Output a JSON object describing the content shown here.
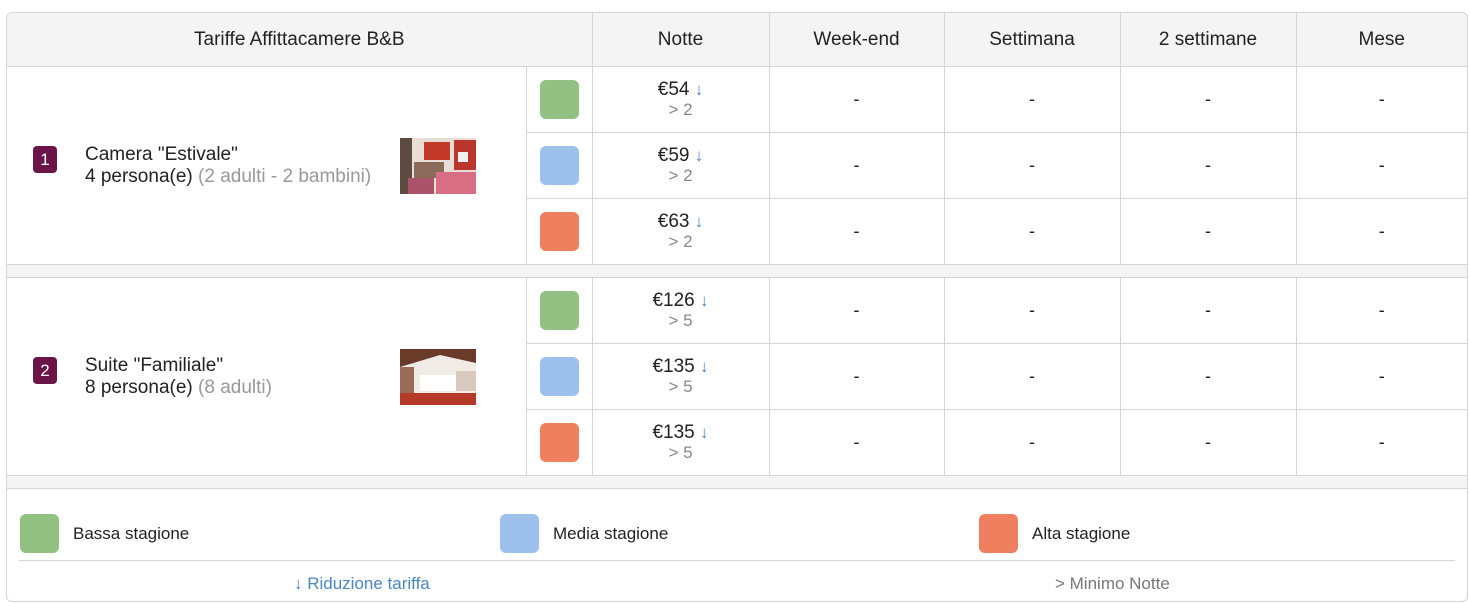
{
  "colors": {
    "low": "#93c083",
    "mid": "#9ec0ec",
    "high": "#ee8060",
    "badge": "#6b1448",
    "link": "#4a86c8"
  },
  "header": {
    "title": "Tariffe Affittacamere B&B",
    "columns": [
      "Notte",
      "Week-end",
      "Settimana",
      "2 settimane",
      "Mese"
    ]
  },
  "rooms": [
    {
      "number": "1",
      "name": "Camera \"Estivale\"",
      "capacity": "4 persona(e)",
      "detail": "(2 adulti - 2 bambini)",
      "thumbnail": "room-photo-estivale",
      "rates": [
        {
          "season": "low",
          "price": "€54",
          "arrow": "↓",
          "min": "> 2",
          "weekend": "-",
          "week": "-",
          "two_weeks": "-",
          "month": "-"
        },
        {
          "season": "mid",
          "price": "€59",
          "arrow": "↓",
          "min": "> 2",
          "weekend": "-",
          "week": "-",
          "two_weeks": "-",
          "month": "-"
        },
        {
          "season": "high",
          "price": "€63",
          "arrow": "↓",
          "min": "> 2",
          "weekend": "-",
          "week": "-",
          "two_weeks": "-",
          "month": "-"
        }
      ]
    },
    {
      "number": "2",
      "name": "Suite \"Familiale\"",
      "capacity": "8 persona(e)",
      "detail": "(8 adulti)",
      "thumbnail": "room-photo-familiale",
      "rates": [
        {
          "season": "low",
          "price": "€126",
          "arrow": "↓",
          "min": "> 5",
          "weekend": "-",
          "week": "-",
          "two_weeks": "-",
          "month": "-"
        },
        {
          "season": "mid",
          "price": "€135",
          "arrow": "↓",
          "min": "> 5",
          "weekend": "-",
          "week": "-",
          "two_weeks": "-",
          "month": "-"
        },
        {
          "season": "high",
          "price": "€135",
          "arrow": "↓",
          "min": "> 5",
          "weekend": "-",
          "week": "-",
          "two_weeks": "-",
          "month": "-"
        }
      ]
    }
  ],
  "legend": {
    "low": "Bassa stagione",
    "mid": "Media stagione",
    "high": "Alta stagione",
    "reduction": "↓ Riduzione tariffa",
    "min_nights": "> Minimo Notte"
  }
}
